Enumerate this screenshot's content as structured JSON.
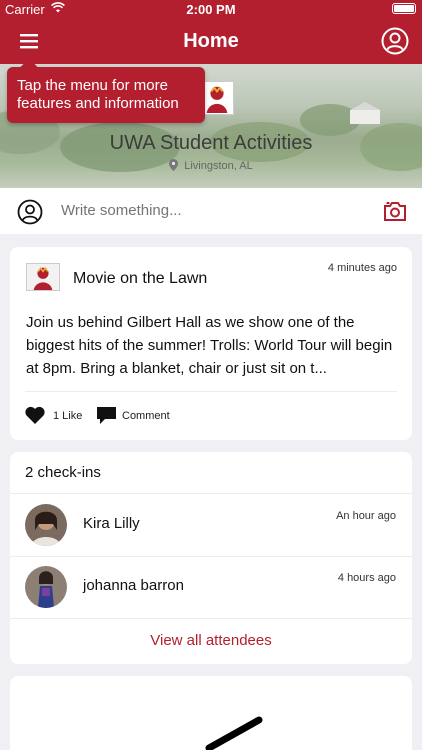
{
  "status_bar": {
    "carrier": "Carrier",
    "time": "2:00 PM"
  },
  "nav": {
    "title": "Home",
    "menu_icon": "hamburger-icon",
    "profile_icon": "user-circle-icon"
  },
  "tooltip": {
    "text": "Tap the menu for more features and information"
  },
  "hero": {
    "org_name": "UWA Student Activities",
    "location": "Livingston, AL"
  },
  "compose": {
    "placeholder": "Write something...",
    "camera_icon": "camera-icon"
  },
  "post": {
    "title": "Movie on the Lawn",
    "time": "4 minutes ago",
    "body": "Join us behind Gilbert Hall as we show one of the biggest hits of the summer!   Trolls: World Tour will begin at 8pm.  Bring a blanket, chair or just sit on t...",
    "like_label": "1 Like",
    "comment_label": "Comment"
  },
  "checkins": {
    "heading": "2 check-ins",
    "attendees": [
      {
        "name": "Kira Lilly",
        "time": "An hour ago"
      },
      {
        "name": "johanna barron",
        "time": "4 hours ago"
      }
    ],
    "view_all": "View all attendees"
  },
  "colors": {
    "brand": "#b41f2f",
    "background": "#efeff4"
  }
}
